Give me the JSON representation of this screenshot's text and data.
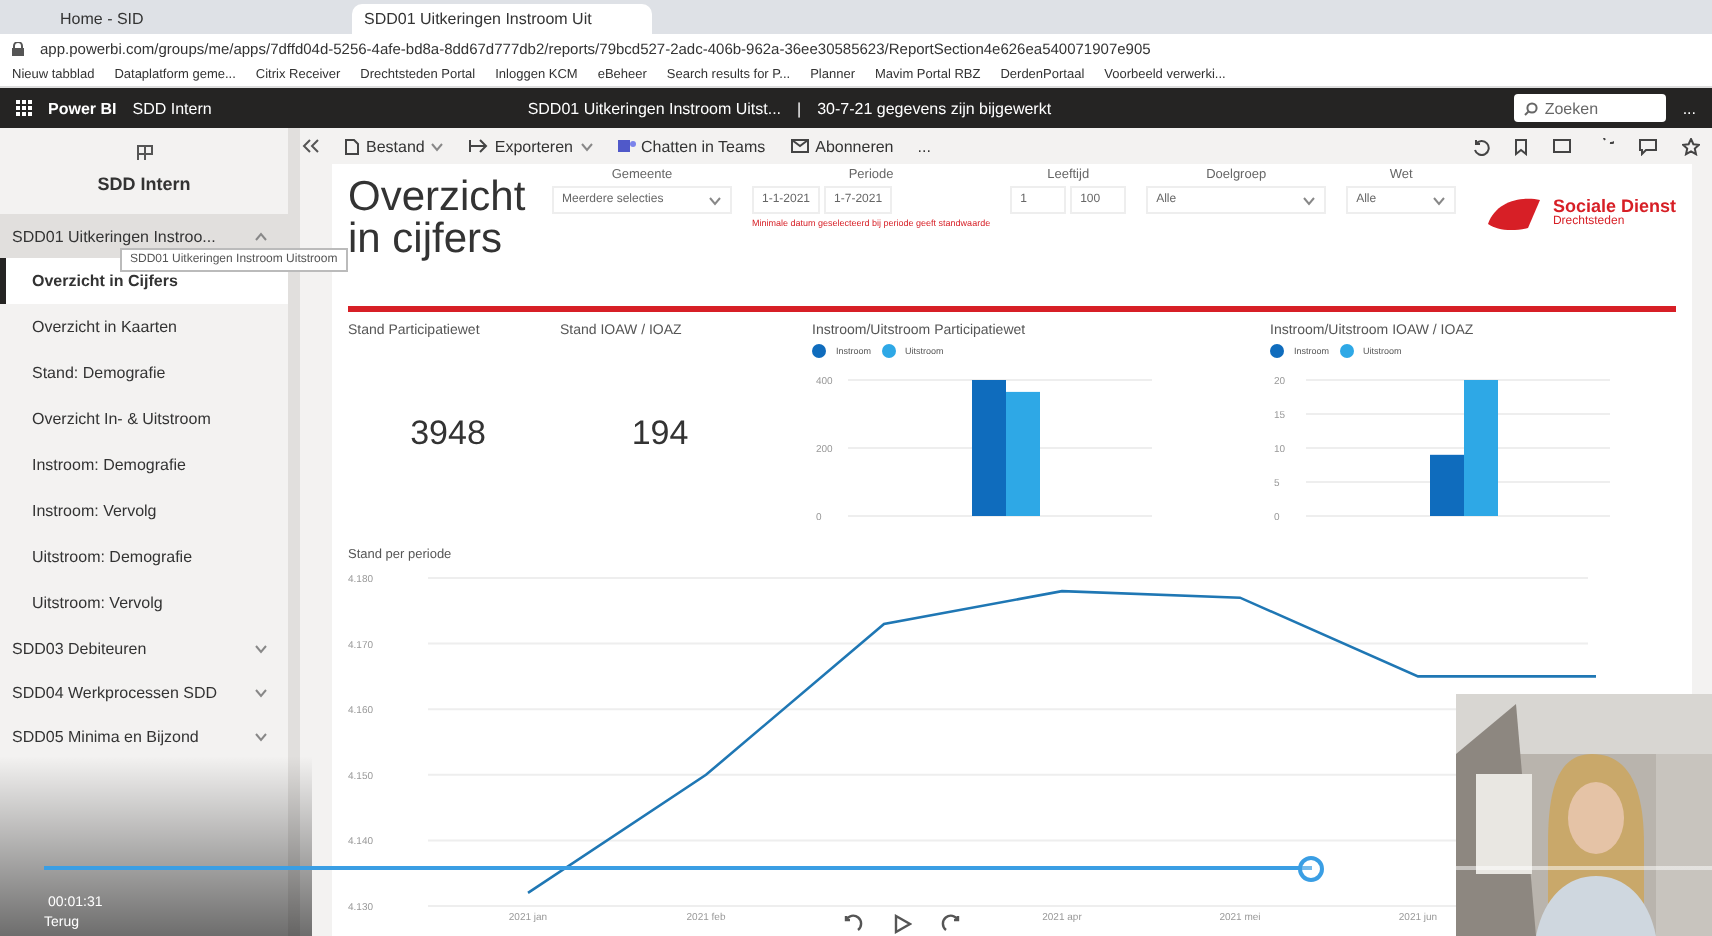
{
  "browser": {
    "tabs": [
      {
        "title": "Home - SID",
        "selected": false
      },
      {
        "title": "SDD01 Uitkeringen Instroom Uit",
        "selected": true
      }
    ],
    "url": "app.powerbi.com/groups/me/apps/7dffd04d-5256-4afe-bd8a-8dd67d777db2/reports/79bcd527-2adc-406b-962a-36ee30585623/ReportSection4e626ea540071907e905",
    "bookmarks": [
      "Nieuw tabblad",
      "Dataplatform geme...",
      "Citrix Receiver",
      "Drechtsteden Portal",
      "Inloggen KCM",
      "eBeheer",
      "Search results for P...",
      "Planner",
      "Mavim Portal RBZ",
      "DerdenPortaal",
      "Voorbeeld verwerki..."
    ]
  },
  "header": {
    "app": "Power BI",
    "workspace": "SDD Intern",
    "report_title": "SDD01 Uitkeringen Instroom Uitst...",
    "separator": "|",
    "updated": "30-7-21 gegevens zijn bijgewerkt",
    "search": {
      "placeholder": "Zoeken"
    },
    "more": "..."
  },
  "toolbar": {
    "items": [
      {
        "kind": "file",
        "label": "Bestand"
      },
      {
        "kind": "export",
        "label": "Exporteren"
      },
      {
        "kind": "teams",
        "label": "Chatten in Teams"
      },
      {
        "kind": "mail",
        "label": "Abonneren"
      },
      {
        "kind": "more",
        "label": "..."
      }
    ]
  },
  "sidebar": {
    "title": "SDD Intern",
    "tooltip": "SDD01 Uitkeringen Instroom Uitstroom",
    "sections": [
      {
        "label": "SDD01 Uitkeringen Instroo...",
        "expanded": true,
        "children": [
          {
            "label": "Overzicht in Cijfers",
            "selected": true
          },
          {
            "label": "Overzicht in Kaarten",
            "selected": false
          },
          {
            "label": "Stand: Demografie",
            "selected": false
          },
          {
            "label": "Overzicht In- & Uitstroom",
            "selected": false
          },
          {
            "label": "Instroom: Demografie",
            "selected": false
          },
          {
            "label": "Instroom: Vervolg",
            "selected": false
          },
          {
            "label": "Uitstroom: Demografie",
            "selected": false
          },
          {
            "label": "Uitstroom: Vervolg",
            "selected": false
          }
        ]
      },
      {
        "label": "SDD03 Debiteuren",
        "expanded": false
      },
      {
        "label": "SDD04 Werkprocessen SDD",
        "expanded": false
      },
      {
        "label": "SDD05 Minima en Bijzond",
        "expanded": false
      }
    ]
  },
  "report": {
    "title": "Overzicht in cijfers",
    "filters": [
      {
        "label": "Gemeente",
        "kind": "dropdown",
        "value": "Meerdere selecties"
      },
      {
        "label": "Periode",
        "kind": "range",
        "from": "1-1-2021",
        "to": "1-7-2021",
        "note": "Minimale datum geselecteerd bij periode geeft standwaarde"
      },
      {
        "label": "Leeftijd",
        "kind": "range",
        "from": "1",
        "to": "100"
      },
      {
        "label": "Doelgroep",
        "kind": "dropdown",
        "value": "Alle"
      },
      {
        "label": "Wet",
        "kind": "dropdown",
        "value": "Alle"
      }
    ],
    "logo": {
      "name": "Sociale Dienst",
      "sub": "Drechtsteden"
    },
    "cards": [
      {
        "label": "Stand Participatiewet",
        "value": "3948"
      },
      {
        "label": "Stand IOAW / IOAZ",
        "value": "194"
      }
    ],
    "bar_charts": [
      {
        "chart_data": {
          "type": "bar",
          "title": "Instroom/Uitstroom Participatiewet",
          "categories": [
            null
          ],
          "series": [
            {
              "name": "Instroom",
              "color": "#0f6cbd",
              "values": [
                400
              ]
            },
            {
              "name": "Uitstroom",
              "color": "#2ea8e6",
              "values": [
                365
              ]
            }
          ],
          "ylim": [
            0,
            400
          ],
          "yticks": [
            0,
            200,
            400
          ],
          "grid": true
        }
      },
      {
        "chart_data": {
          "type": "bar",
          "title": "Instroom/Uitstroom IOAW / IOAZ",
          "categories": [
            null
          ],
          "series": [
            {
              "name": "Instroom",
              "color": "#0f6cbd",
              "values": [
                9
              ]
            },
            {
              "name": "Uitstroom",
              "color": "#2ea8e6",
              "values": [
                20
              ]
            }
          ],
          "ylim": [
            0,
            20
          ],
          "yticks": [
            0,
            5,
            10,
            15,
            20
          ],
          "grid": true
        }
      }
    ],
    "line_chart": {
      "chart_data": {
        "type": "line",
        "title": "Stand per periode",
        "categories": [
          "2021 jan",
          "2021 feb",
          null,
          "2021 apr",
          "2021 mei",
          "2021 jun",
          null
        ],
        "series": [
          {
            "color": "#1f77b4",
            "values": [
              4132,
              4150,
              4173,
              4178,
              4177,
              4165,
              4165
            ]
          }
        ],
        "ylim": [
          4130,
          4180
        ],
        "yticks": [
          {
            "value": 4130,
            "label": "4.130"
          },
          {
            "value": 4140,
            "label": "4.140"
          },
          {
            "value": 4150,
            "label": "4.150"
          },
          {
            "value": 4160,
            "label": "4.160"
          },
          {
            "value": 4170,
            "label": "4.170"
          },
          {
            "value": 4180,
            "label": "4.180"
          }
        ],
        "grid": true
      }
    }
  },
  "video": {
    "time": "00:01:31",
    "back": "Terug",
    "progress": {
      "level": 0.76
    }
  }
}
